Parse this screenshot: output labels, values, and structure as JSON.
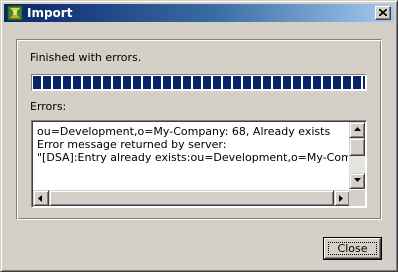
{
  "window": {
    "title": "Import",
    "app_icon": "import-app-icon",
    "close_icon": "close-icon"
  },
  "status": {
    "text": "Finished with errors.",
    "progress_fraction": 1.0
  },
  "errors": {
    "label": "Errors:",
    "lines": [
      "ou=Development,o=My-Company: 68, Already exists",
      "Error message returned by server:",
      "\"[DSA]:Entry already exists:ou=Development,o=My-Company\""
    ]
  },
  "footer": {
    "close_label": "Close"
  },
  "colors": {
    "titlebar_start": "#0a246a",
    "titlebar_end": "#a6caf0",
    "progress_block": "#0a246a",
    "face": "#d4d0c8"
  }
}
